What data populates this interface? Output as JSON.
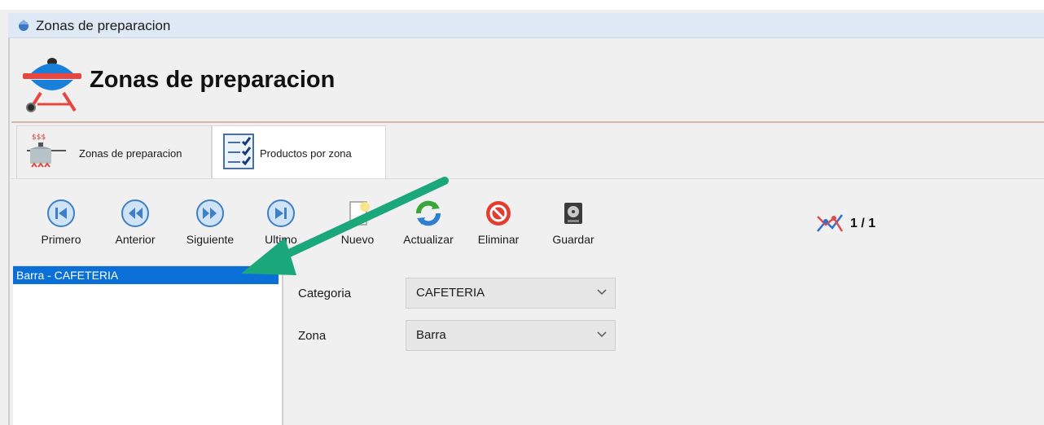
{
  "window": {
    "title": "Zonas de preparacion"
  },
  "header": {
    "title": "Zonas de preparacion"
  },
  "tabs": [
    {
      "label": "Zonas de preparacion",
      "icon": "cooking-pot-icon",
      "selected": false
    },
    {
      "label": "Productos por zona",
      "icon": "checklist-icon",
      "selected": true
    }
  ],
  "toolbar": {
    "primero": "Primero",
    "anterior": "Anterior",
    "siguiente": "Siguiente",
    "ultimo": "Ultimo",
    "nuevo": "Nuevo",
    "actualizar": "Actualizar",
    "eliminar": "Eliminar",
    "guardar": "Guardar"
  },
  "record_counter": {
    "text": "1 / 1"
  },
  "list": {
    "items": [
      {
        "label": "Barra - CAFETERIA",
        "selected": true
      }
    ]
  },
  "form": {
    "categoria_label": "Categoria",
    "categoria_value": "CAFETERIA",
    "zona_label": "Zona",
    "zona_value": "Barra"
  },
  "colors": {
    "selection": "#0a6fd7",
    "arrow": "#1aa77a",
    "titlebar": "#dfe9f5"
  }
}
